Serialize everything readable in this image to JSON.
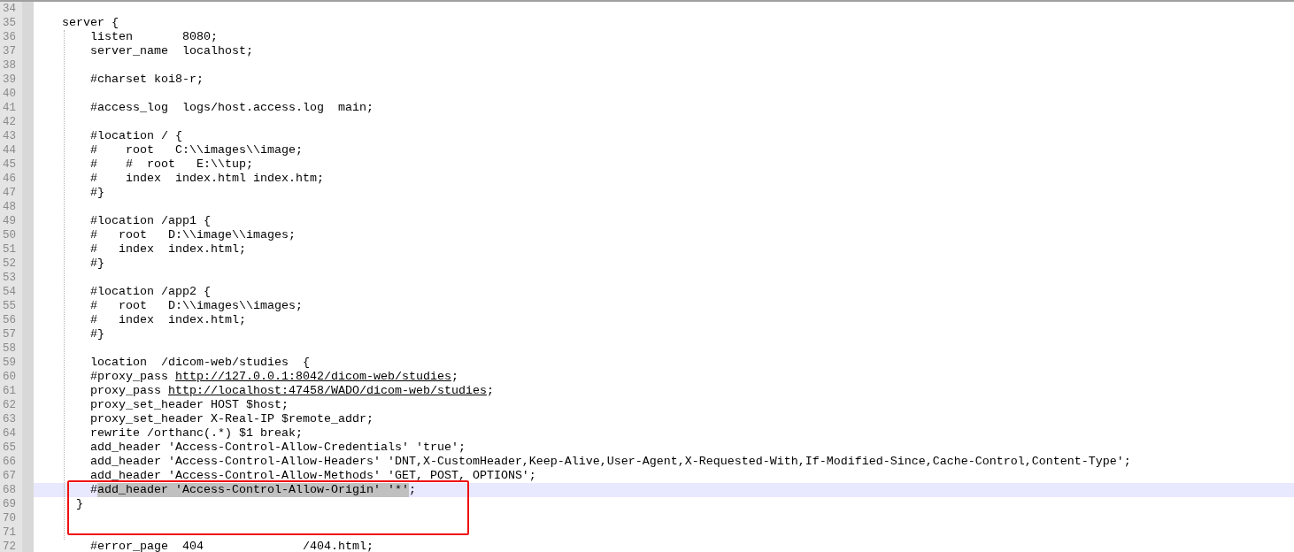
{
  "editor": {
    "lines": [
      {
        "number": "34",
        "current": false
      },
      {
        "number": "35",
        "current": false,
        "segments": [
          {
            "kind": "plain",
            "text": "    server {"
          }
        ]
      },
      {
        "number": "36",
        "current": false,
        "segments": [
          {
            "kind": "plain",
            "text": "        listen       8080;"
          }
        ]
      },
      {
        "number": "37",
        "current": false,
        "segments": [
          {
            "kind": "plain",
            "text": "        server_name  localhost;"
          }
        ]
      },
      {
        "number": "38",
        "current": false
      },
      {
        "number": "39",
        "current": false,
        "segments": [
          {
            "kind": "plain",
            "text": "        #charset koi8-r;"
          }
        ]
      },
      {
        "number": "40",
        "current": false
      },
      {
        "number": "41",
        "current": false,
        "segments": [
          {
            "kind": "plain",
            "text": "        #access_log  logs/host.access.log  main;"
          }
        ]
      },
      {
        "number": "42",
        "current": false
      },
      {
        "number": "43",
        "current": false,
        "segments": [
          {
            "kind": "plain",
            "text": "        #location / {"
          }
        ]
      },
      {
        "number": "44",
        "current": false,
        "segments": [
          {
            "kind": "plain",
            "text": "        #    root   C:\\\\images\\\\image;"
          }
        ]
      },
      {
        "number": "45",
        "current": false,
        "segments": [
          {
            "kind": "plain",
            "text": "        #    #  root   E:\\\\tup;"
          }
        ]
      },
      {
        "number": "46",
        "current": false,
        "segments": [
          {
            "kind": "plain",
            "text": "        #    index  index.html index.htm;"
          }
        ]
      },
      {
        "number": "47",
        "current": false,
        "segments": [
          {
            "kind": "plain",
            "text": "        #}"
          }
        ]
      },
      {
        "number": "48",
        "current": false
      },
      {
        "number": "49",
        "current": false,
        "segments": [
          {
            "kind": "plain",
            "text": "        #location /app1 {"
          }
        ]
      },
      {
        "number": "50",
        "current": false,
        "segments": [
          {
            "kind": "plain",
            "text": "        #   root   D:\\\\image\\\\images;"
          }
        ]
      },
      {
        "number": "51",
        "current": false,
        "segments": [
          {
            "kind": "plain",
            "text": "        #   index  index.html;"
          }
        ]
      },
      {
        "number": "52",
        "current": false,
        "segments": [
          {
            "kind": "plain",
            "text": "        #}"
          }
        ]
      },
      {
        "number": "53",
        "current": false
      },
      {
        "number": "54",
        "current": false,
        "segments": [
          {
            "kind": "plain",
            "text": "        #location /app2 {"
          }
        ]
      },
      {
        "number": "55",
        "current": false,
        "segments": [
          {
            "kind": "plain",
            "text": "        #   root   D:\\\\images\\\\images;"
          }
        ]
      },
      {
        "number": "56",
        "current": false,
        "segments": [
          {
            "kind": "plain",
            "text": "        #   index  index.html;"
          }
        ]
      },
      {
        "number": "57",
        "current": false,
        "segments": [
          {
            "kind": "plain",
            "text": "        #}"
          }
        ]
      },
      {
        "number": "58",
        "current": false
      },
      {
        "number": "59",
        "current": false,
        "segments": [
          {
            "kind": "plain",
            "text": "        location  /dicom-web/studies  {"
          }
        ]
      },
      {
        "number": "60",
        "current": false,
        "segments": [
          {
            "kind": "plain",
            "text": "        #proxy_pass "
          },
          {
            "kind": "link",
            "text": "http://127.0.0.1:8042/dicom-web/studies"
          },
          {
            "kind": "plain",
            "text": ";"
          }
        ]
      },
      {
        "number": "61",
        "current": false,
        "segments": [
          {
            "kind": "plain",
            "text": "        proxy_pass "
          },
          {
            "kind": "link",
            "text": "http://localhost:47458/WADO/dicom-web/studies"
          },
          {
            "kind": "plain",
            "text": ";"
          }
        ]
      },
      {
        "number": "62",
        "current": false,
        "segments": [
          {
            "kind": "plain",
            "text": "        proxy_set_header HOST $host;"
          }
        ]
      },
      {
        "number": "63",
        "current": false,
        "segments": [
          {
            "kind": "plain",
            "text": "        proxy_set_header X-Real-IP $remote_addr;"
          }
        ]
      },
      {
        "number": "64",
        "current": false,
        "segments": [
          {
            "kind": "plain",
            "text": "        rewrite /orthanc(.*) $1 break;"
          }
        ]
      },
      {
        "number": "65",
        "current": false,
        "segments": [
          {
            "kind": "plain",
            "text": "        add_header 'Access-Control-Allow-Credentials' 'true';"
          }
        ]
      },
      {
        "number": "66",
        "current": false,
        "segments": [
          {
            "kind": "plain",
            "text": "        add_header 'Access-Control-Allow-Headers' 'DNT,X-CustomHeader,Keep-Alive,User-Agent,X-Requested-With,If-Modified-Since,Cache-Control,Content-Type';"
          }
        ]
      },
      {
        "number": "67",
        "current": false,
        "segments": [
          {
            "kind": "plain",
            "text": "        add_header 'Access-Control-Allow-Methods' 'GET, POST, OPTIONS';"
          }
        ]
      },
      {
        "number": "68",
        "current": true,
        "segments": [
          {
            "kind": "plain",
            "text": "        #"
          },
          {
            "kind": "selected",
            "text": "add_header 'Access-Control-Allow-Origin' '*'"
          },
          {
            "kind": "plain",
            "text": ";"
          }
        ]
      },
      {
        "number": "69",
        "current": false,
        "segments": [
          {
            "kind": "plain",
            "text": "      }"
          }
        ]
      },
      {
        "number": "70",
        "current": false
      },
      {
        "number": "71",
        "current": false
      },
      {
        "number": "72",
        "current": false,
        "segments": [
          {
            "kind": "plain",
            "text": "        #error_page  404              /404.html;"
          }
        ]
      }
    ]
  }
}
